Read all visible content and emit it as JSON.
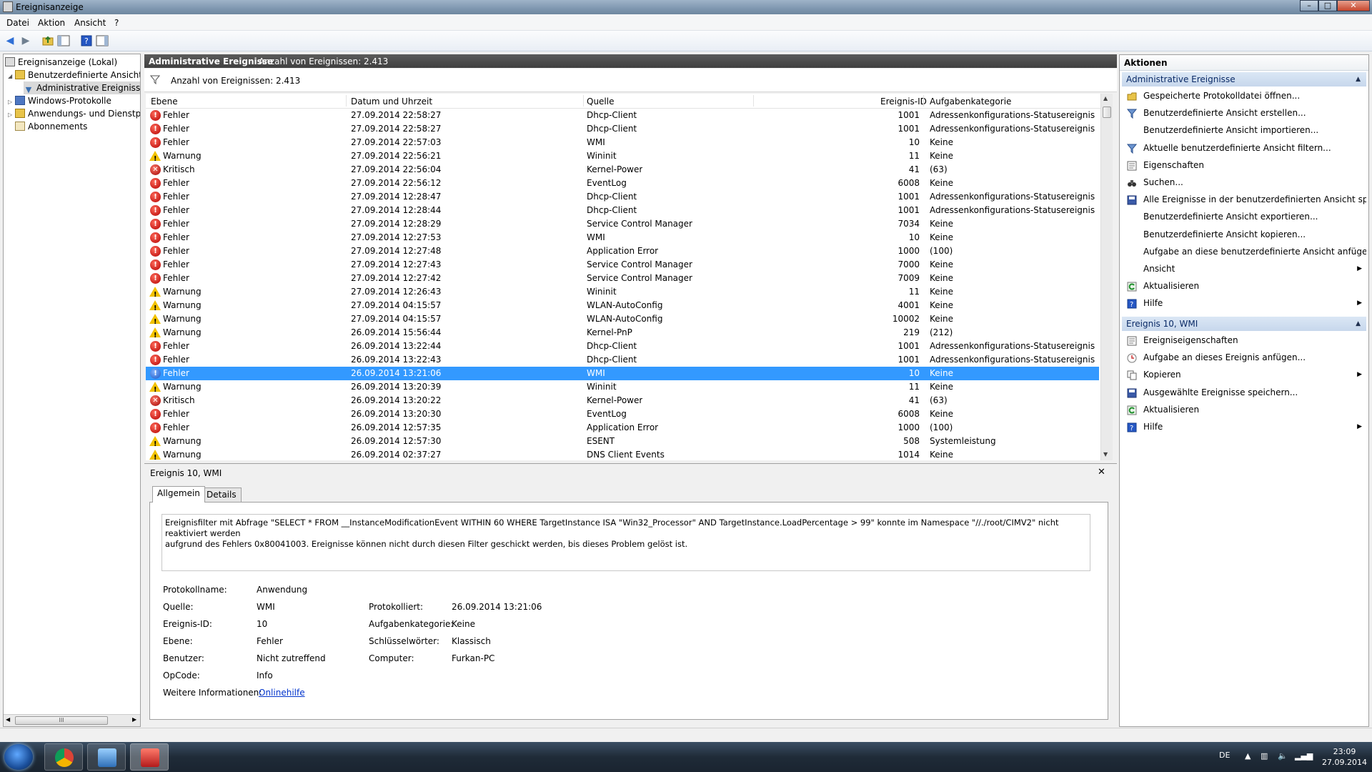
{
  "window": {
    "title": "Ereignisanzeige",
    "min": "–",
    "max": "□",
    "close": "✕"
  },
  "menu": [
    "Datei",
    "Aktion",
    "Ansicht",
    "?"
  ],
  "tree": {
    "items": [
      {
        "label": "Ereignisanzeige (Lokal)",
        "level": 0,
        "exp": ""
      },
      {
        "label": "Benutzerdefinierte Ansichten",
        "level": 1,
        "exp": "◢"
      },
      {
        "label": "Administrative Ereignisse",
        "level": 2,
        "exp": ""
      },
      {
        "label": "Windows-Protokolle",
        "level": 1,
        "exp": "▷"
      },
      {
        "label": "Anwendungs- und Dienstprotokolle",
        "level": 1,
        "exp": "▷"
      },
      {
        "label": "Abonnements",
        "level": 1,
        "exp": ""
      }
    ],
    "scroll_grip": "III"
  },
  "center": {
    "header_title": "Administrative Ereignisse",
    "header_count": "Anzahl von Ereignissen: 2.413",
    "filter_text": "Anzahl von Ereignissen: 2.413"
  },
  "grid": {
    "columns": [
      "Ebene",
      "Datum und Uhrzeit",
      "Quelle",
      "Ereignis-ID",
      "Aufgabenkategorie"
    ],
    "rows": [
      [
        "Fehler",
        "27.09.2014 22:58:27",
        "Dhcp-Client",
        "1001",
        "Adressenkonfigurations-Statusereignis"
      ],
      [
        "Fehler",
        "27.09.2014 22:58:27",
        "Dhcp-Client",
        "1001",
        "Adressenkonfigurations-Statusereignis"
      ],
      [
        "Fehler",
        "27.09.2014 22:57:03",
        "WMI",
        "10",
        "Keine"
      ],
      [
        "Warnung",
        "27.09.2014 22:56:21",
        "Wininit",
        "11",
        "Keine"
      ],
      [
        "Kritisch",
        "27.09.2014 22:56:04",
        "Kernel-Power",
        "41",
        "(63)"
      ],
      [
        "Fehler",
        "27.09.2014 22:56:12",
        "EventLog",
        "6008",
        "Keine"
      ],
      [
        "Fehler",
        "27.09.2014 12:28:47",
        "Dhcp-Client",
        "1001",
        "Adressenkonfigurations-Statusereignis"
      ],
      [
        "Fehler",
        "27.09.2014 12:28:44",
        "Dhcp-Client",
        "1001",
        "Adressenkonfigurations-Statusereignis"
      ],
      [
        "Fehler",
        "27.09.2014 12:28:29",
        "Service Control Manager",
        "7034",
        "Keine"
      ],
      [
        "Fehler",
        "27.09.2014 12:27:53",
        "WMI",
        "10",
        "Keine"
      ],
      [
        "Fehler",
        "27.09.2014 12:27:48",
        "Application Error",
        "1000",
        "(100)"
      ],
      [
        "Fehler",
        "27.09.2014 12:27:43",
        "Service Control Manager",
        "7000",
        "Keine"
      ],
      [
        "Fehler",
        "27.09.2014 12:27:42",
        "Service Control Manager",
        "7009",
        "Keine"
      ],
      [
        "Warnung",
        "27.09.2014 12:26:43",
        "Wininit",
        "11",
        "Keine"
      ],
      [
        "Warnung",
        "27.09.2014 04:15:57",
        "WLAN-AutoConfig",
        "4001",
        "Keine"
      ],
      [
        "Warnung",
        "27.09.2014 04:15:57",
        "WLAN-AutoConfig",
        "10002",
        "Keine"
      ],
      [
        "Warnung",
        "26.09.2014 15:56:44",
        "Kernel-PnP",
        "219",
        "(212)"
      ],
      [
        "Fehler",
        "26.09.2014 13:22:44",
        "Dhcp-Client",
        "1001",
        "Adressenkonfigurations-Statusereignis"
      ],
      [
        "Fehler",
        "26.09.2014 13:22:43",
        "Dhcp-Client",
        "1001",
        "Adressenkonfigurations-Statusereignis"
      ],
      [
        "Fehler",
        "26.09.2014 13:21:06",
        "WMI",
        "10",
        "Keine"
      ],
      [
        "Warnung",
        "26.09.2014 13:20:39",
        "Wininit",
        "11",
        "Keine"
      ],
      [
        "Kritisch",
        "26.09.2014 13:20:22",
        "Kernel-Power",
        "41",
        "(63)"
      ],
      [
        "Fehler",
        "26.09.2014 13:20:30",
        "EventLog",
        "6008",
        "Keine"
      ],
      [
        "Fehler",
        "26.09.2014 12:57:35",
        "Application Error",
        "1000",
        "(100)"
      ],
      [
        "Warnung",
        "26.09.2014 12:57:30",
        "ESENT",
        "508",
        "Systemleistung"
      ],
      [
        "Warnung",
        "26.09.2014 02:37:27",
        "DNS Client Events",
        "1014",
        "Keine"
      ]
    ],
    "selected_index": 19
  },
  "detail": {
    "title": "Ereignis 10, WMI",
    "close": "✕",
    "tabs": [
      "Allgemein",
      "Details"
    ],
    "description_line1": "Ereignisfilter mit Abfrage \"SELECT * FROM __InstanceModificationEvent WITHIN 60 WHERE TargetInstance ISA \"Win32_Processor\" AND TargetInstance.LoadPercentage > 99\" konnte im Namespace \"//./root/CIMV2\" nicht reaktiviert werden",
    "description_line2": "aufgrund des Fehlers 0x80041003. Ereignisse können nicht durch diesen Filter geschickt werden, bis dieses Problem gelöst ist.",
    "fields": {
      "protokollname_label": "Protokollname:",
      "protokollname": "Anwendung",
      "quelle_label": "Quelle:",
      "quelle": "WMI",
      "protokolliert_label": "Protokolliert:",
      "protokolliert": "26.09.2014 13:21:06",
      "id_label": "Ereignis-ID:",
      "id": "10",
      "aufgabe_label": "Aufgabenkategorie:",
      "aufgabe": "Keine",
      "ebene_label": "Ebene:",
      "ebene": "Fehler",
      "schluessel_label": "Schlüsselwörter:",
      "schluessel": "Klassisch",
      "benutzer_label": "Benutzer:",
      "benutzer": "Nicht zutreffend",
      "computer_label": "Computer:",
      "computer": "Furkan-PC",
      "opcode_label": "OpCode:",
      "opcode": "Info",
      "info_label": "Weitere Informationen:",
      "info_link": "Onlinehilfe"
    }
  },
  "actions": {
    "header": "Aktionen",
    "section1": "Administrative Ereignisse",
    "items1": [
      {
        "label": "Gespeicherte Protokolldatei öffnen...",
        "icon": "folder-icon",
        "arrow": false
      },
      {
        "label": "Benutzerdefinierte Ansicht erstellen...",
        "icon": "filter-icon",
        "arrow": false
      },
      {
        "label": "Benutzerdefinierte Ansicht importieren...",
        "icon": "",
        "arrow": false
      },
      {
        "label": "Aktuelle benutzerdefinierte Ansicht filtern...",
        "icon": "filter-icon",
        "arrow": false
      },
      {
        "label": "Eigenschaften",
        "icon": "properties-icon",
        "arrow": false
      },
      {
        "label": "Suchen...",
        "icon": "binoculars-icon",
        "arrow": false
      },
      {
        "label": "Alle Ereignisse in der benutzerdefinierten Ansicht speic...",
        "icon": "save-icon",
        "arrow": false
      },
      {
        "label": "Benutzerdefinierte Ansicht exportieren...",
        "icon": "",
        "arrow": false
      },
      {
        "label": "Benutzerdefinierte Ansicht kopieren...",
        "icon": "",
        "arrow": false
      },
      {
        "label": "Aufgabe an diese benutzerdefinierte Ansicht anfügen...",
        "icon": "",
        "arrow": false
      },
      {
        "label": "Ansicht",
        "icon": "",
        "arrow": true
      },
      {
        "label": "Aktualisieren",
        "icon": "refresh-icon",
        "arrow": false
      },
      {
        "label": "Hilfe",
        "icon": "help-icon",
        "arrow": true
      }
    ],
    "section2": "Ereignis 10, WMI",
    "items2": [
      {
        "label": "Ereigniseigenschaften",
        "icon": "properties-icon",
        "arrow": false
      },
      {
        "label": "Aufgabe an dieses Ereignis anfügen...",
        "icon": "task-icon",
        "arrow": false
      },
      {
        "label": "Kopieren",
        "icon": "copy-icon",
        "arrow": true
      },
      {
        "label": "Ausgewählte Ereignisse speichern...",
        "icon": "save-icon",
        "arrow": false
      },
      {
        "label": "Aktualisieren",
        "icon": "refresh-icon",
        "arrow": false
      },
      {
        "label": "Hilfe",
        "icon": "help-icon",
        "arrow": true
      }
    ]
  },
  "taskbar": {
    "lang": "DE",
    "time": "23:09",
    "date": "27.09.2014"
  },
  "colors": {
    "selection": "#3399ff",
    "section_text": "#0a2a66",
    "link": "#0033cc"
  }
}
